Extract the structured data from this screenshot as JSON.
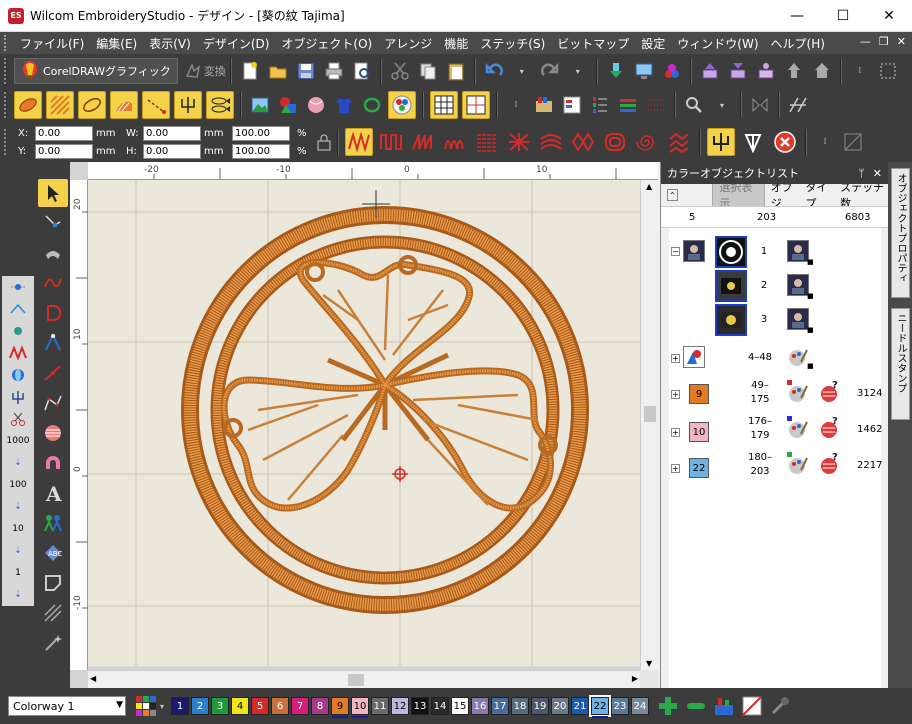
{
  "window": {
    "icon_text": "ES",
    "title": "Wilcom EmbroideryStudio - デザイン - [葵の紋        Tajima]",
    "controls": [
      "—",
      "☐",
      "✕"
    ]
  },
  "menu": {
    "items": [
      "ファイル(F)",
      "編集(E)",
      "表示(V)",
      "デザイン(D)",
      "オブジェクト(O)",
      "アレンジ",
      "機能",
      "ステッチ(S)",
      "ビットマップ",
      "設定",
      "ウィンドウ(W)",
      "ヘルプ(H)"
    ],
    "mdi_controls": [
      "—",
      "❐",
      "✕"
    ]
  },
  "toolbar1": {
    "corel_label": "CorelDRAWグラフィック",
    "henkan_label": "変換"
  },
  "toolbar3": {
    "x_label": "X:",
    "x_value": "0.00",
    "y_label": "Y:",
    "y_value": "0.00",
    "w_label": "W:",
    "w_value": "0.00",
    "h_label": "H:",
    "h_value": "0.00",
    "unit": "mm",
    "pct_w": "100.00",
    "pct_h": "100.00",
    "pct_unit": "%"
  },
  "left_numbers": [
    "1000",
    "100",
    "10",
    "1"
  ],
  "rulers": {
    "top_labels": [
      "-20",
      "-10",
      "0",
      "10"
    ],
    "left_labels": [
      "20",
      "10",
      "0",
      "-10"
    ]
  },
  "panel": {
    "title": "カラーオブジェクトリスト",
    "pin": "ᛘ",
    "close": "✕",
    "select_display": "選択表示",
    "col_object": "オブジ",
    "col_type": "タイプ",
    "col_stitches": "ステッチ数",
    "sum_count": "5",
    "sum_objects": "203",
    "sum_stitches": "6803",
    "rows": [
      {
        "kind": "bitmap",
        "num": "1"
      },
      {
        "kind": "bitmap",
        "num": "2"
      },
      {
        "kind": "bitmap",
        "num": "3"
      },
      {
        "kind": "group",
        "range": "4–48"
      },
      {
        "kind": "color",
        "color_num": "9",
        "color": "#e27b22",
        "range_a": "49–",
        "range_b": "175",
        "stitches": "3124"
      },
      {
        "kind": "color",
        "color_num": "10",
        "color": "#f3b6c0",
        "range_a": "176–",
        "range_b": "179",
        "stitches": "1462"
      },
      {
        "kind": "color",
        "color_num": "22",
        "color": "#6fb2e3",
        "range_a": "180–",
        "range_b": "203",
        "stitches": "2217"
      }
    ]
  },
  "side_tabs": [
    "オブジェクトプロパティ",
    "ニードルスタンプ"
  ],
  "bottom": {
    "colorway": "Colorway 1",
    "swatches": [
      {
        "n": "1",
        "c": "#1a1a6e",
        "fg": "#fff"
      },
      {
        "n": "2",
        "c": "#2a7fd0",
        "fg": "#fff"
      },
      {
        "n": "3",
        "c": "#1e9a3a",
        "fg": "#fff"
      },
      {
        "n": "4",
        "c": "#f2e51a",
        "fg": "#000"
      },
      {
        "n": "5",
        "c": "#d42a2a",
        "fg": "#fff"
      },
      {
        "n": "6",
        "c": "#c8703a",
        "fg": "#fff"
      },
      {
        "n": "7",
        "c": "#d61e7a",
        "fg": "#fff"
      },
      {
        "n": "8",
        "c": "#a43a8a",
        "fg": "#fff"
      },
      {
        "n": "9",
        "c": "#e27b22",
        "fg": "#000",
        "ul": true
      },
      {
        "n": "10",
        "c": "#f3b6c0",
        "fg": "#000",
        "ul": true
      },
      {
        "n": "11",
        "c": "#6a6a6a",
        "fg": "#fff"
      },
      {
        "n": "12",
        "c": "#c0b8e0",
        "fg": "#000"
      },
      {
        "n": "13",
        "c": "#111111",
        "fg": "#fff"
      },
      {
        "n": "14",
        "c": "#2a2a2a",
        "fg": "#fff"
      },
      {
        "n": "15",
        "c": "#ffffff",
        "fg": "#000"
      },
      {
        "n": "16",
        "c": "#8a7ab0",
        "fg": "#fff"
      },
      {
        "n": "17",
        "c": "#4a6a9a",
        "fg": "#fff"
      },
      {
        "n": "18",
        "c": "#5a6a7a",
        "fg": "#fff"
      },
      {
        "n": "19",
        "c": "#4a5a6a",
        "fg": "#fff"
      },
      {
        "n": "20",
        "c": "#6a7a8a",
        "fg": "#fff"
      },
      {
        "n": "21",
        "c": "#1a5ab0",
        "fg": "#fff"
      },
      {
        "n": "22",
        "c": "#6fb2e3",
        "fg": "#000",
        "ul": true,
        "cur": true
      },
      {
        "n": "23",
        "c": "#5a7a9a",
        "fg": "#fff"
      },
      {
        "n": "24",
        "c": "#7a8a9a",
        "fg": "#fff"
      }
    ]
  }
}
